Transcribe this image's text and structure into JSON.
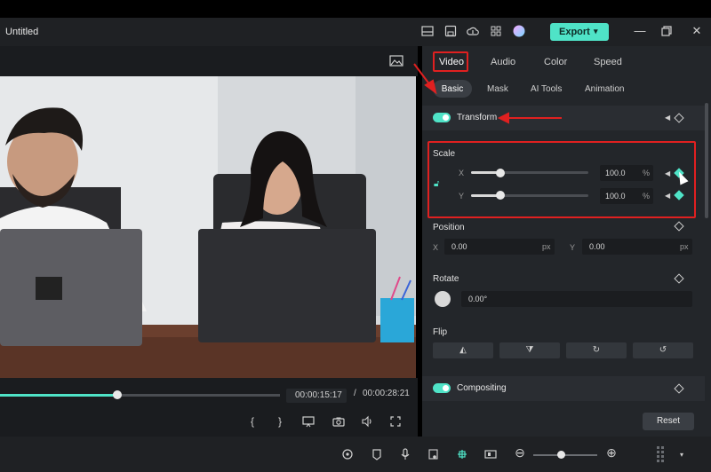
{
  "window": {
    "title": "Untitled",
    "export_label": "Export"
  },
  "preview": {
    "current_time": "00:00:15:17",
    "separator": "/",
    "total_time": "00:00:28:21",
    "progress": 0.42
  },
  "panel": {
    "tabs": [
      {
        "label": "Video",
        "active": true
      },
      {
        "label": "Audio",
        "active": false
      },
      {
        "label": "Color",
        "active": false
      },
      {
        "label": "Speed",
        "active": false
      }
    ],
    "subtabs": [
      {
        "label": "Basic",
        "active": true
      },
      {
        "label": "Mask",
        "active": false
      },
      {
        "label": "AI Tools",
        "active": false
      },
      {
        "label": "Animation",
        "active": false
      }
    ],
    "transform": {
      "label": "Transform",
      "enabled": true,
      "scale": {
        "label": "Scale",
        "x": {
          "axis": "X",
          "value": "100.0",
          "unit": "%",
          "slider_fraction": 0.25
        },
        "y": {
          "axis": "Y",
          "value": "100.0",
          "unit": "%",
          "slider_fraction": 0.25
        }
      },
      "position": {
        "label": "Position",
        "x": {
          "axis": "X",
          "value": "0.00",
          "unit": "px"
        },
        "y": {
          "axis": "Y",
          "value": "0.00",
          "unit": "px"
        }
      },
      "rotate": {
        "label": "Rotate",
        "value": "0.00°"
      },
      "flip": {
        "label": "Flip"
      }
    },
    "compositing": {
      "label": "Compositing",
      "enabled": true
    },
    "reset_label": "Reset"
  },
  "colors": {
    "accent": "#4fe3c7",
    "highlight": "#e02020",
    "panel_bg": "#23262a"
  }
}
